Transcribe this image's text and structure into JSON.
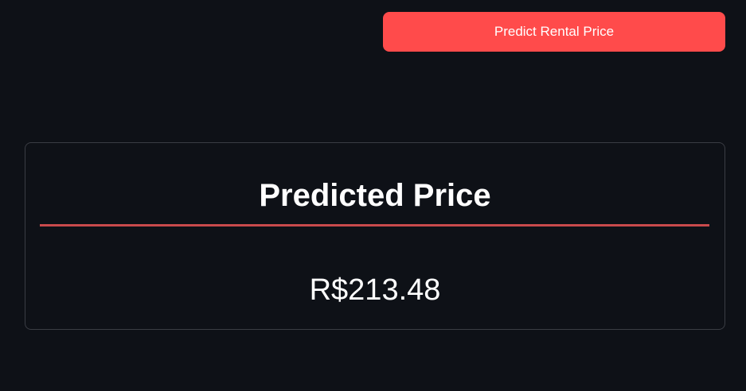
{
  "actions": {
    "predict_button_label": "Predict Rental Price"
  },
  "result": {
    "title": "Predicted Price",
    "price": "R$213.48"
  },
  "colors": {
    "background": "#0e1117",
    "accent": "#ff4b4b",
    "divider": "#c94a4c",
    "card_border": "#3a3d44"
  }
}
